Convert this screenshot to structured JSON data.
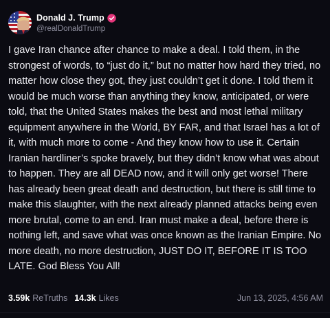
{
  "author": {
    "display_name": "Donald J. Trump",
    "handle": "@realDonaldTrump",
    "avatar_icon": "profile-photo-flag-avatar",
    "verified_icon": "verified-badge-icon",
    "verified_color": "#e5357a"
  },
  "post": {
    "text": "I gave Iran chance after chance to make a deal. I told them, in the strongest of words, to “just do it,” but no matter how hard they tried, no matter how close they got, they just couldn’t get it done. I told them it would be much worse than anything they know, anticipated, or were told, that the United States makes the best and most lethal military equipment anywhere in the World, BY FAR, and that Israel has a lot of it, with much more to come - And they know how to use it. Certain Iranian hardliner’s spoke bravely, but they didn’t know what was about to happen. They are all DEAD now, and it will only get worse! There has already been great death and destruction, but there is still time to make this slaughter, with the next already planned attacks being even more brutal, come to an end. Iran must make a deal, before there is nothing left, and save what was once known as the Iranian Empire. No more death, no more destruction, JUST DO IT, BEFORE IT IS TOO LATE. God Bless You All!"
  },
  "stats": {
    "retruths_count": "3.59k",
    "retruths_label": "ReTruths",
    "likes_count": "14.3k",
    "likes_label": "Likes",
    "timestamp": "Jun 13, 2025, 4:56 AM"
  },
  "colors": {
    "background": "#0b0b12",
    "text": "#ebebf0",
    "muted": "#8e8e9e"
  }
}
